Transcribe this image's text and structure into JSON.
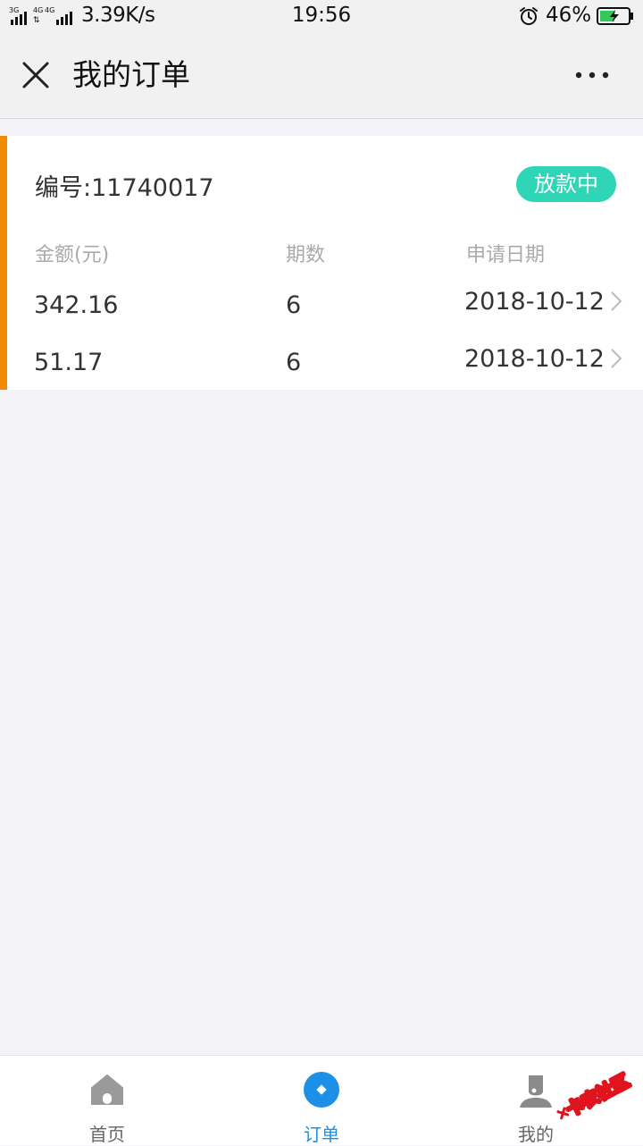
{
  "status_bar": {
    "network_speed": "3.39K/s",
    "time": "19:56",
    "battery_percent": "46%",
    "signal_labels": [
      "3G",
      "4G",
      "4G"
    ],
    "icons": [
      "signal-icon",
      "alarm-icon",
      "battery-charging-icon"
    ]
  },
  "header": {
    "title": "我的订单",
    "close_icon": "close-icon",
    "more_icon": "more-icon"
  },
  "order": {
    "number_label": "编号:11740017",
    "status": "放款中",
    "columns": {
      "amount": "金额(元)",
      "periods": "期数",
      "date": "申请日期"
    },
    "rows": [
      {
        "amount": "342.16",
        "periods": "6",
        "date": "2018-10-12"
      },
      {
        "amount": "51.17",
        "periods": "6",
        "date": "2018-10-12"
      }
    ]
  },
  "tabs": [
    {
      "label": "首页",
      "icon": "home-icon",
      "active": false
    },
    {
      "label": "订单",
      "icon": "order-icon",
      "active": true
    },
    {
      "label": "我的",
      "icon": "user-icon",
      "active": false
    }
  ],
  "watermark": {
    "text": "卡农社区"
  },
  "colors": {
    "accent_orange": "#f08a00",
    "status_green": "#2fd5b7",
    "active_blue": "#1c8fe6"
  }
}
